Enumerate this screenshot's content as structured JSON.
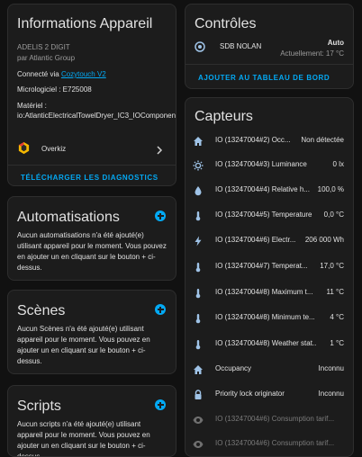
{
  "device_info": {
    "title": "Informations Appareil",
    "model": "ADELIS 2 DIGIT",
    "manufacturer": "par Atlantic Group",
    "connected_label": "Connecté via",
    "connected_link": "Cozytouch V2",
    "firmware": "Micrologiciel : E725008",
    "hardware_label": "Matériel :",
    "hardware_value": "io:AtlanticElectricalTowelDryer_IC3_IOComponent",
    "integration_name": "Overkiz",
    "download_label": "Télécharger les diagnostics"
  },
  "automations": {
    "title": "Automatisations",
    "text": "Aucun automatisations n'a été ajouté(e) utilisant appareil pour le moment. Vous pouvez en ajouter un en cliquant sur le bouton + ci-dessus."
  },
  "scenes": {
    "title": "Scènes",
    "text": "Aucun Scènes n'a été ajouté(e) utilisant appareil pour le moment. Vous pouvez en ajouter un en cliquant sur le bouton + ci-dessus."
  },
  "scripts": {
    "title": "Scripts",
    "text": "Aucun scripts n'a été ajouté(e) utilisant appareil pour le moment. Vous pouvez en ajouter un en cliquant sur le bouton + ci-dessus."
  },
  "controls": {
    "title": "Contrôles",
    "entity_name": "SDB NOLAN",
    "state": "Auto",
    "current": "Actuellement: 17 °C",
    "add_dashboard": "Ajouter au tableau de bord"
  },
  "sensors": {
    "title": "Capteurs",
    "rows": [
      {
        "icon": "home-icon",
        "name": "IO (13247004#2) Occ...",
        "value": "Non détectée",
        "dim": false
      },
      {
        "icon": "brightness-icon",
        "name": "IO (13247004#3) Luminance",
        "value": "0 lx",
        "dim": false
      },
      {
        "icon": "water-drop-icon",
        "name": "IO (13247004#4) Relative h...",
        "value": "100,0 %",
        "dim": false
      },
      {
        "icon": "thermometer-icon",
        "name": "IO (13247004#5) Temperature",
        "value": "0,0 °C",
        "dim": false
      },
      {
        "icon": "flash-icon",
        "name": "IO (13247004#6) Electr...",
        "value": "206 000 Wh",
        "dim": false
      },
      {
        "icon": "thermometer-icon",
        "name": "IO (13247004#7) Temperat...",
        "value": "17,0 °C",
        "dim": false
      },
      {
        "icon": "thermometer-icon",
        "name": "IO (13247004#8) Maximum t...",
        "value": "11 °C",
        "dim": false
      },
      {
        "icon": "thermometer-icon",
        "name": "IO (13247004#8) Minimum te...",
        "value": "4 °C",
        "dim": false
      },
      {
        "icon": "thermometer-icon",
        "name": "IO (13247004#8) Weather stat...",
        "value": "1 °C",
        "dim": false
      },
      {
        "icon": "home-icon",
        "name": "Occupancy",
        "value": "Inconnu",
        "dim": false
      },
      {
        "icon": "lock-icon",
        "name": "Priority lock originator",
        "value": "Inconnu",
        "dim": false
      },
      {
        "icon": "eye-icon",
        "name": "IO (13247004#6) Consumption tarif...",
        "value": "",
        "dim": true
      },
      {
        "icon": "eye-icon",
        "name": "IO (13247004#6) Consumption tarif...",
        "value": "",
        "dim": true
      }
    ]
  },
  "colors": {
    "accent": "#03a9f4",
    "background": "#111111",
    "card": "#1c1c1c",
    "icon": "#9fc3e7"
  }
}
